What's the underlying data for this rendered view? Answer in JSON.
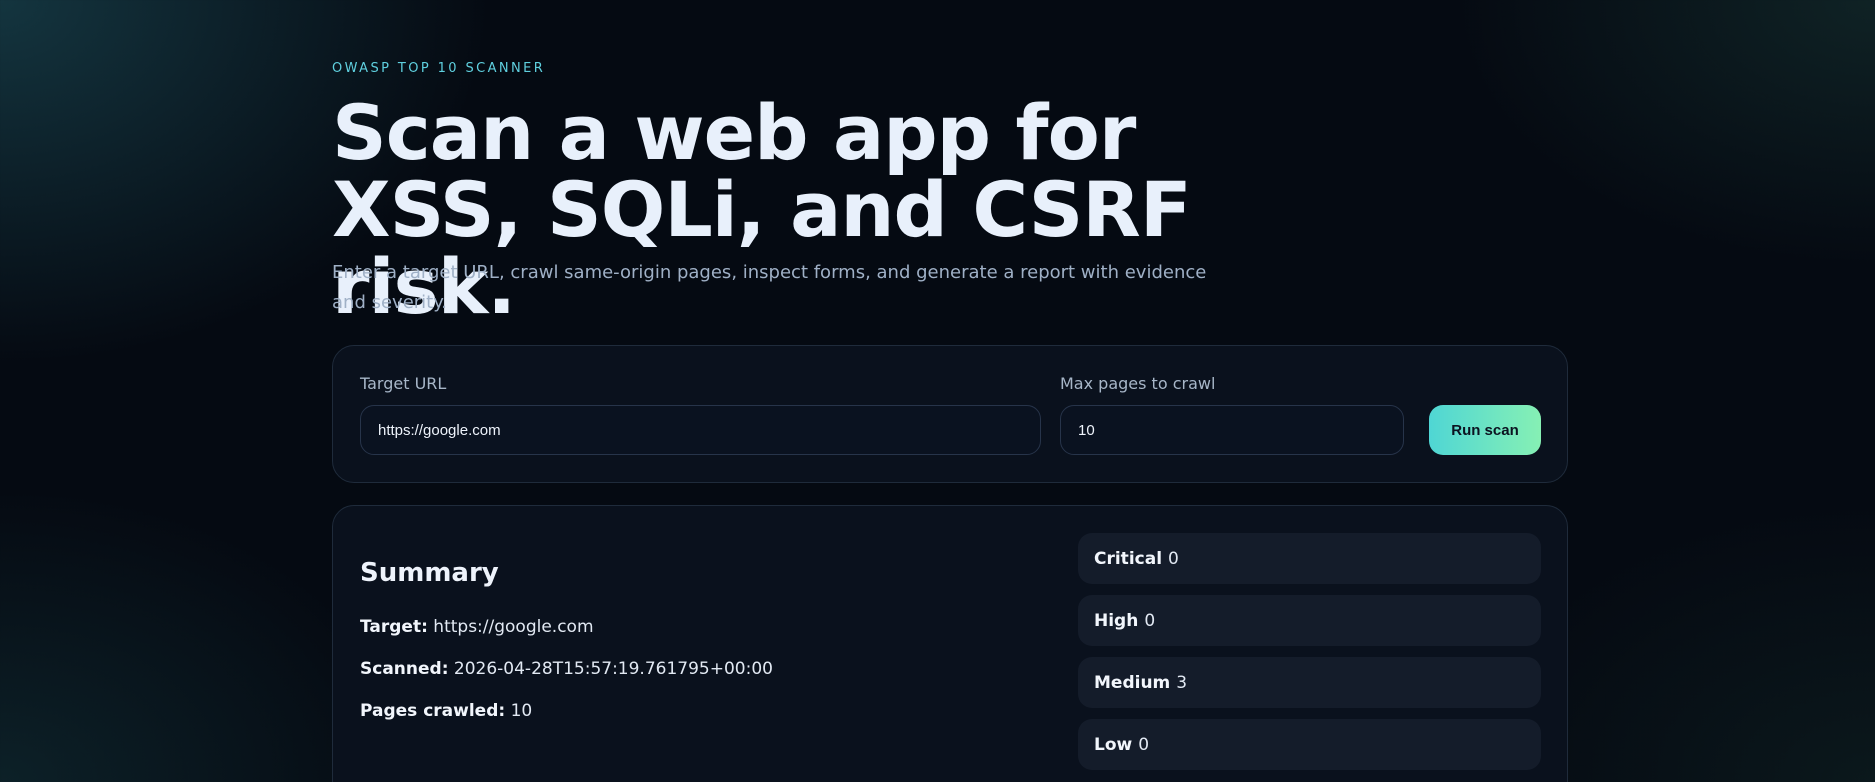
{
  "header": {
    "eyebrow": "OWASP TOP 10 SCANNER",
    "title": "Scan a web app for XSS, SQLi, and CSRF risk.",
    "subtitle": "Enter a target URL, crawl same-origin pages, inspect forms, and generate a report with evidence and severity."
  },
  "scan_form": {
    "target_url": {
      "label": "Target URL",
      "value": "https://google.com"
    },
    "max_pages": {
      "label": "Max pages to crawl",
      "value": "10"
    },
    "run_button_label": "Run scan"
  },
  "summary": {
    "title": "Summary",
    "target_label": "Target:",
    "target_value": "https://google.com",
    "scanned_label": "Scanned:",
    "scanned_value": "2026-04-28T15:57:19.761795+00:00",
    "pages_label": "Pages crawled:",
    "pages_value": "10",
    "severity_counts": [
      {
        "label": "Critical",
        "count": "0"
      },
      {
        "label": "High",
        "count": "0"
      },
      {
        "label": "Medium",
        "count": "3"
      },
      {
        "label": "Low",
        "count": "0"
      }
    ]
  }
}
